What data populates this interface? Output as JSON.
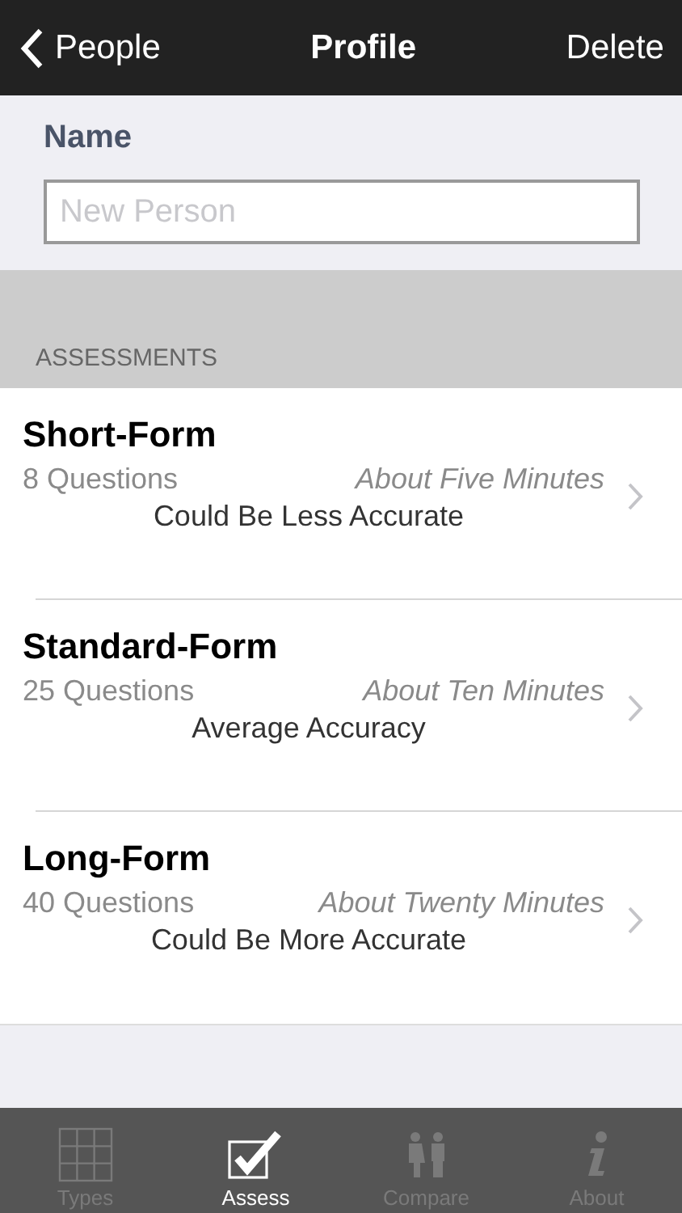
{
  "nav": {
    "back": "People",
    "title": "Profile",
    "action": "Delete"
  },
  "name_section": {
    "label": "Name",
    "placeholder": "New Person"
  },
  "section_header": "ASSESSMENTS",
  "assessments": [
    {
      "title": "Short-Form",
      "questions": "8 Questions",
      "duration": "About Five Minutes",
      "accuracy": "Could Be Less Accurate"
    },
    {
      "title": "Standard-Form",
      "questions": "25 Questions",
      "duration": "About Ten Minutes",
      "accuracy": "Average Accuracy"
    },
    {
      "title": "Long-Form",
      "questions": "40 Questions",
      "duration": "About Twenty Minutes",
      "accuracy": "Could Be More Accurate"
    }
  ],
  "tabs": [
    {
      "label": "Types",
      "kind": "grid",
      "selected": false
    },
    {
      "label": "Assess",
      "kind": "check",
      "selected": true
    },
    {
      "label": "Compare",
      "kind": "people",
      "selected": false
    },
    {
      "label": "About",
      "kind": "info",
      "selected": false
    }
  ]
}
